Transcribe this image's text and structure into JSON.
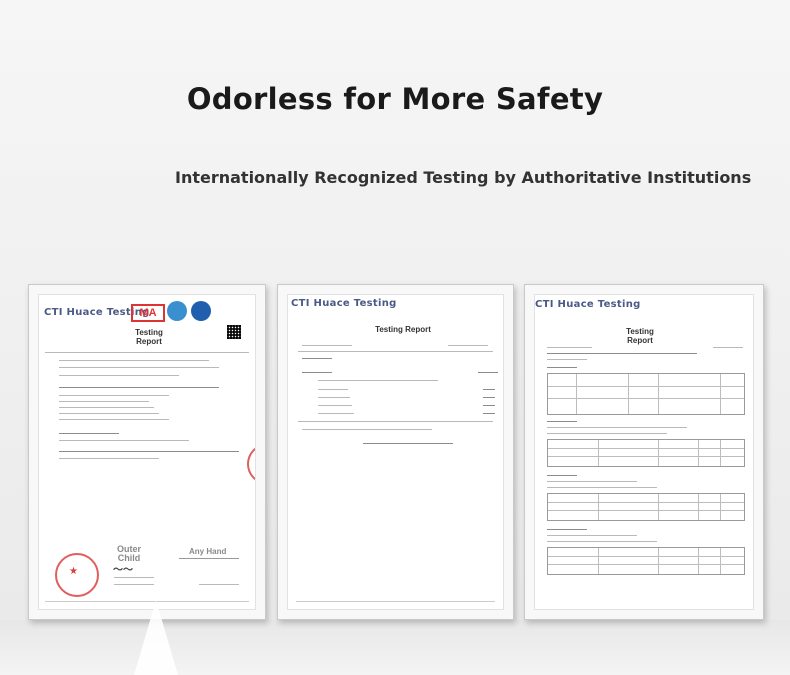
{
  "headline": "Odorless for More Safety",
  "subheadline": "Internationally Recognized Testing by Authoritative Institutions",
  "certificates": [
    {
      "brand": "CTI Huace Testing",
      "title_line1": "Testing",
      "title_line2": "Report",
      "marks": [
        "MA",
        "ilac-MRA",
        "CNAS"
      ],
      "annotation_left": "Outer Child",
      "annotation_right": "Any Hand"
    },
    {
      "brand": "CTI Huace Testing",
      "title": "Testing Report"
    },
    {
      "brand": "CTI Huace Testing",
      "title_line1": "Testing",
      "title_line2": "Report"
    }
  ],
  "colors": {
    "brand_text": "#4a5a86",
    "stamp_red": "#d72828",
    "headline": "#1a1a1a"
  }
}
